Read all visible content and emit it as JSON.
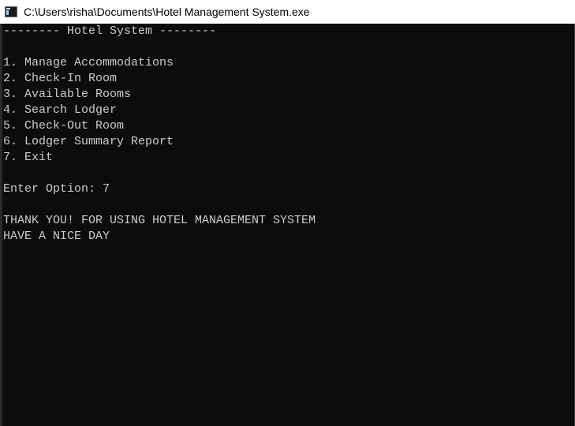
{
  "window": {
    "title": "C:\\Users\\risha\\Documents\\Hotel Management System.exe"
  },
  "console": {
    "lines": [
      "-------- Hotel System --------",
      "",
      "1. Manage Accommodations",
      "2. Check-In Room",
      "3. Available Rooms",
      "4. Search Lodger",
      "5. Check-Out Room",
      "6. Lodger Summary Report",
      "7. Exit",
      "",
      "Enter Option: 7",
      "",
      "THANK YOU! FOR USING HOTEL MANAGEMENT SYSTEM",
      "HAVE A NICE DAY"
    ]
  },
  "colors": {
    "background": "#0c0c0c",
    "text": "#cccccc",
    "titlebar": "#ffffff"
  }
}
